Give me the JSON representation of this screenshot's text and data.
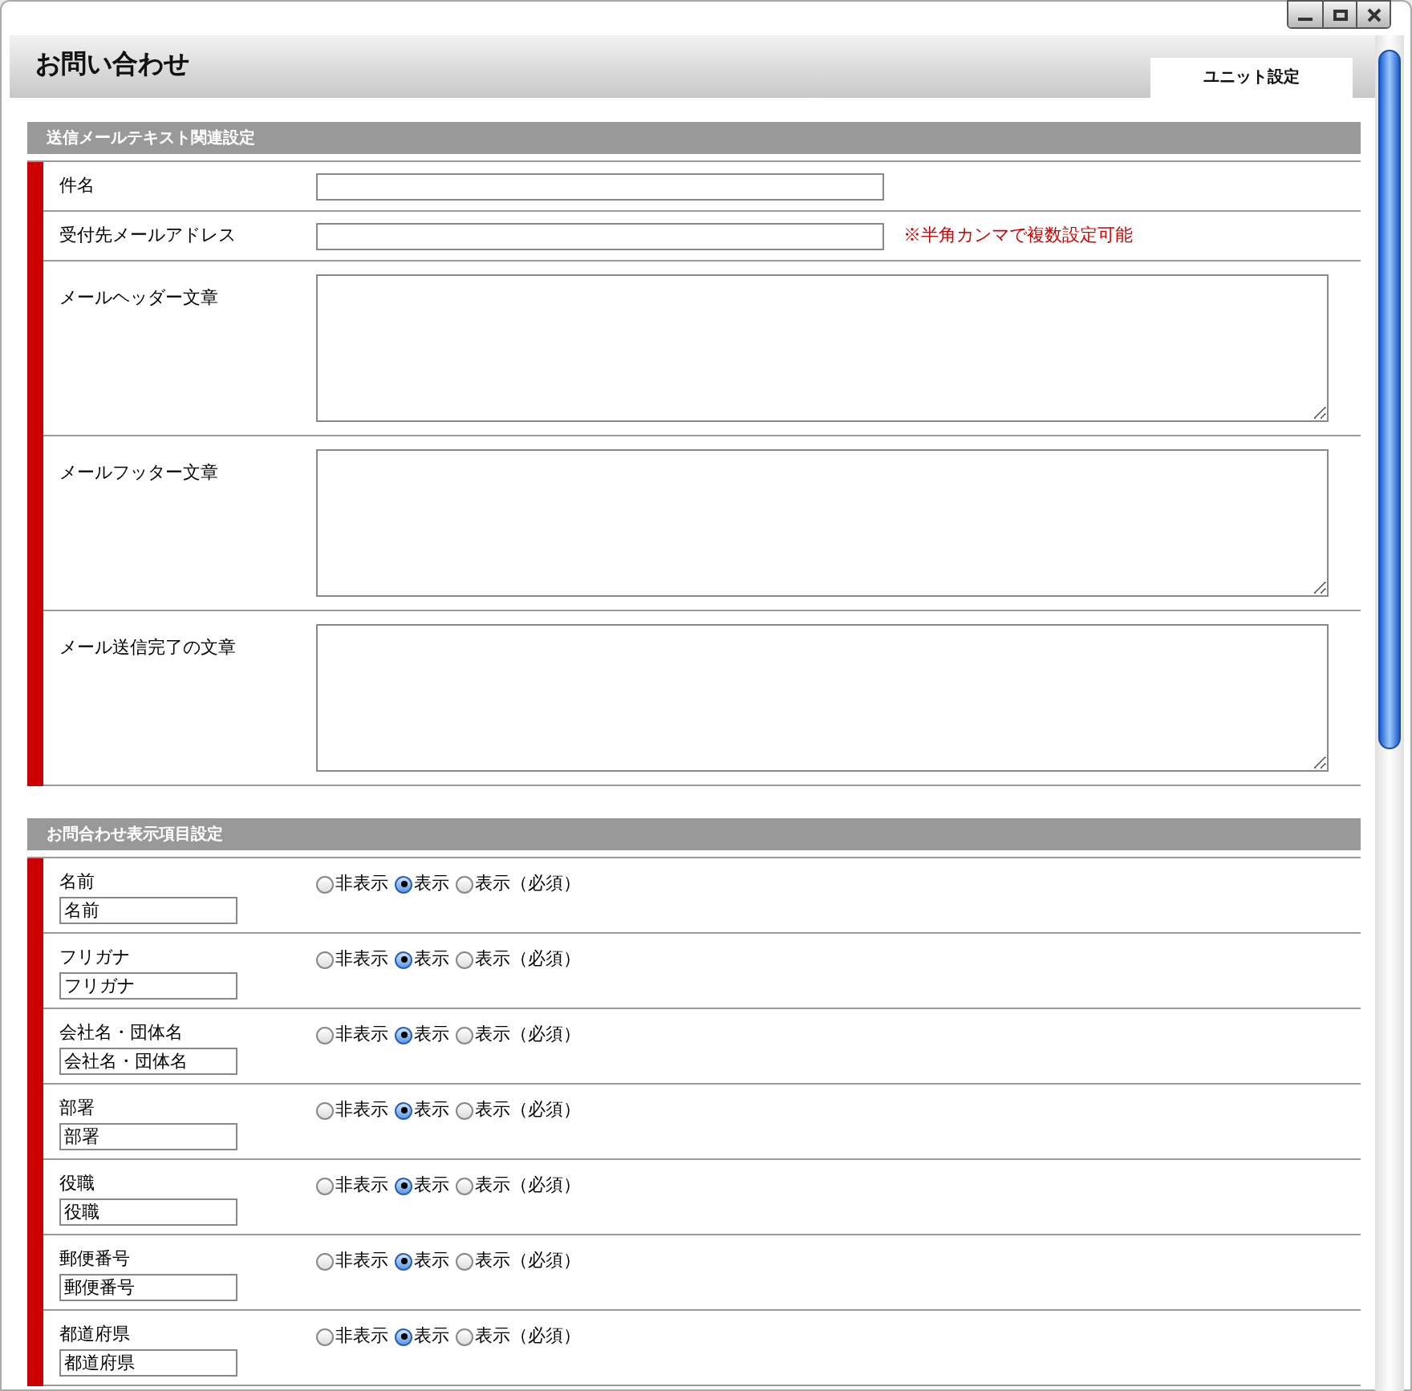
{
  "page": {
    "title": "お問い合わせ",
    "tab": "ユニット設定"
  },
  "mail_section": {
    "title": "送信メールテキスト関連設定",
    "fields": [
      {
        "kind": "input",
        "label": "件名"
      },
      {
        "kind": "input",
        "label": "受付先メールアドレス",
        "note": "※半角カンマで複数設定可能"
      },
      {
        "kind": "textarea",
        "label": "メールヘッダー文章"
      },
      {
        "kind": "textarea",
        "label": "メールフッター文章"
      },
      {
        "kind": "textarea",
        "label": "メール送信完了の文章"
      }
    ]
  },
  "display_section": {
    "title": "お問合わせ表示項目設定",
    "items": [
      {
        "label": "名前",
        "value": "名前",
        "options": [
          {
            "label": "非表示",
            "selected": false
          },
          {
            "label": "表示",
            "selected": true
          },
          {
            "label": "表示（必須）",
            "selected": false
          }
        ]
      },
      {
        "label": "フリガナ",
        "value": "フリガナ",
        "options": [
          {
            "label": "非表示",
            "selected": false
          },
          {
            "label": "表示",
            "selected": true
          },
          {
            "label": "表示（必須）",
            "selected": false
          }
        ]
      },
      {
        "label": "会社名・団体名",
        "value": "会社名・団体名",
        "options": [
          {
            "label": "非表示",
            "selected": false
          },
          {
            "label": "表示",
            "selected": true
          },
          {
            "label": "表示（必須）",
            "selected": false
          }
        ]
      },
      {
        "label": "部署",
        "value": "部署",
        "options": [
          {
            "label": "非表示",
            "selected": false
          },
          {
            "label": "表示",
            "selected": true
          },
          {
            "label": "表示（必須）",
            "selected": false
          }
        ]
      },
      {
        "label": "役職",
        "value": "役職",
        "options": [
          {
            "label": "非表示",
            "selected": false
          },
          {
            "label": "表示",
            "selected": true
          },
          {
            "label": "表示（必須）",
            "selected": false
          }
        ]
      },
      {
        "label": "郵便番号",
        "value": "郵便番号",
        "options": [
          {
            "label": "非表示",
            "selected": false
          },
          {
            "label": "表示",
            "selected": true
          },
          {
            "label": "表示（必須）",
            "selected": false
          }
        ]
      },
      {
        "label": "都道府県",
        "value": "都道府県",
        "options": [
          {
            "label": "非表示",
            "selected": false
          },
          {
            "label": "表示",
            "selected": true
          },
          {
            "label": "表示（必須）",
            "selected": false
          }
        ]
      }
    ]
  }
}
